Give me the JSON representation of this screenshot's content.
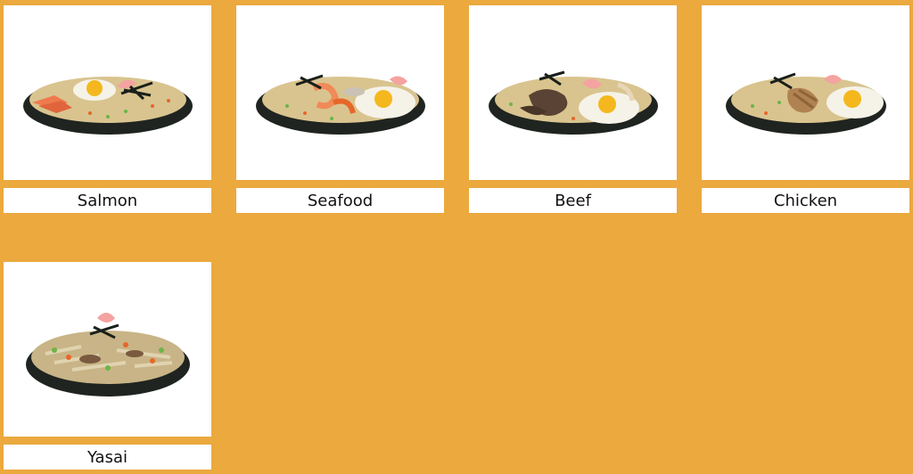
{
  "menu": {
    "items": [
      {
        "name": "Salmon",
        "icon": "salmon-fried-rice-plate-icon"
      },
      {
        "name": "Seafood",
        "icon": "seafood-fried-rice-plate-icon"
      },
      {
        "name": "Beef",
        "icon": "beef-fried-rice-plate-icon"
      },
      {
        "name": "Chicken",
        "icon": "chicken-fried-rice-plate-icon"
      },
      {
        "name": "Yasai",
        "icon": "vegetable-fried-rice-plate-icon"
      }
    ]
  },
  "colors": {
    "background": "#EBA93E",
    "card": "#FFFFFF",
    "plate": "#1F2420",
    "rice": "#D9C48F",
    "egg_yolk": "#F4B81E",
    "egg_white": "#F5F2E8",
    "salmon": "#EE7A4E",
    "shrimp": "#F08A58",
    "beef": "#5A4334",
    "chicken": "#B08252",
    "ginger": "#F4A3A0",
    "nori": "#1A1F1A",
    "peas": "#6BB547",
    "carrot": "#E6672A",
    "mushroom": "#7A5A3E"
  }
}
